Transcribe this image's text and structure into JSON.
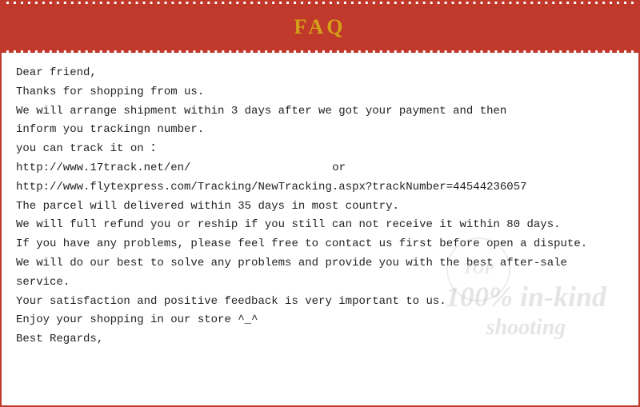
{
  "header": {
    "title": "FAQ"
  },
  "content": {
    "line1": "Dear friend,",
    "line2": "Thanks for shopping from us.",
    "line3": "We will arrange shipment within 3 days after we got your payment and then",
    "line4": "inform you trackingn number.",
    "line5": "you can track it on ：",
    "line6a": "http://www.17track.net/en/",
    "line6b": "or",
    "line7": "http://www.flytexpress.com/Tracking/NewTracking.aspx?trackNumber=44544236057",
    "line8": "The parcel will delivered within 35 days in most country.",
    "line9": "We will full refund you or reship if you still can not receive it within 80 days.",
    "line10": "If you have any problems, please feel free to contact us first before open a dispute.",
    "line11": "We will do our best to solve any problems and provide you with the best after-sale",
    "line12": "service.",
    "line13": "Your satisfaction and positive feedback is very important to us.",
    "line14": "Enjoy your shopping in our store ^_^",
    "line15": "Best Regards,"
  },
  "watermark": {
    "circle_text": "TOP",
    "line1": "100% in-kind",
    "line2": "shooting"
  }
}
